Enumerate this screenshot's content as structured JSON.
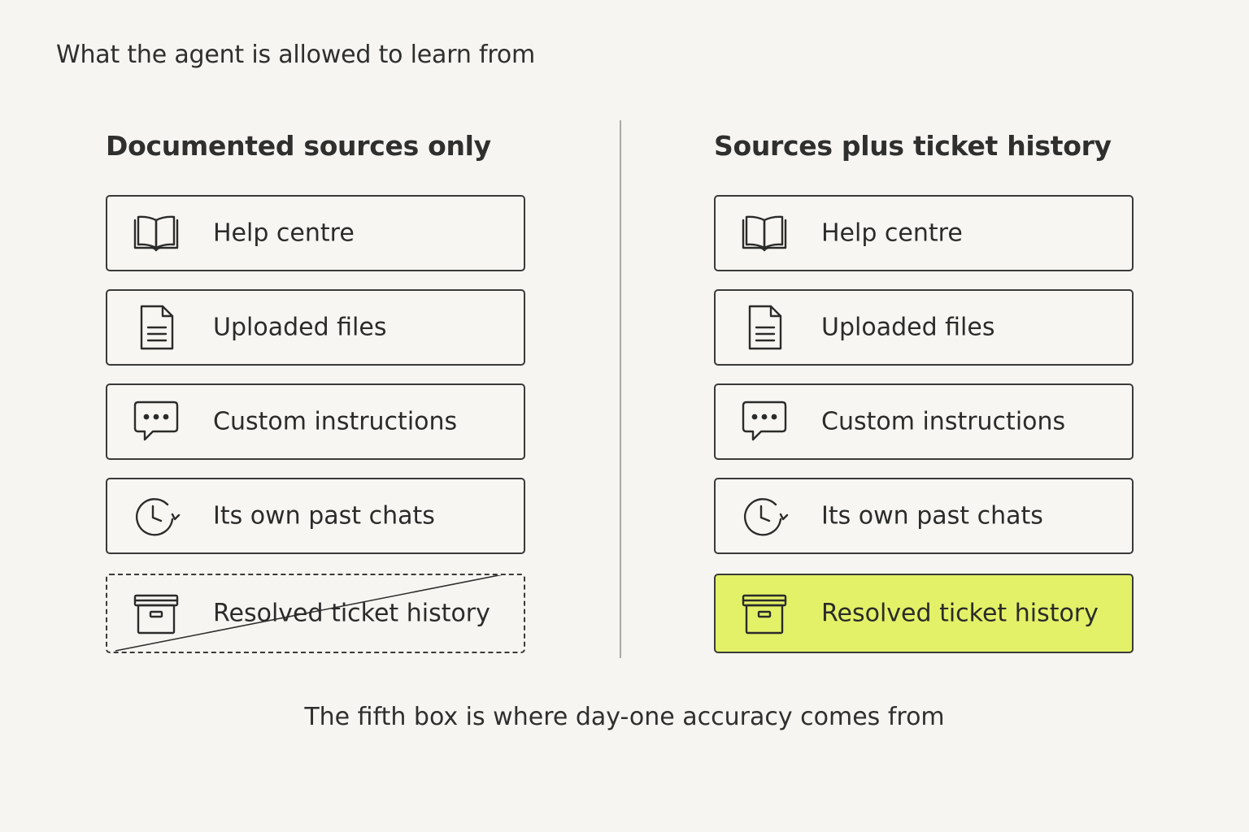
{
  "title": "What the agent is allowed to learn from",
  "columns": [
    {
      "heading": "Documented sources only",
      "items": [
        {
          "label": "Help centre",
          "icon": "book-icon"
        },
        {
          "label": "Uploaded files",
          "icon": "document-icon"
        },
        {
          "label": "Custom instructions",
          "icon": "chat-bubble-icon"
        },
        {
          "label": "Its own past chats",
          "icon": "history-clock-icon"
        },
        {
          "label": "Resolved ticket history",
          "icon": "archive-box-icon",
          "state": "excluded"
        }
      ]
    },
    {
      "heading": "Sources plus ticket history",
      "items": [
        {
          "label": "Help centre",
          "icon": "book-icon"
        },
        {
          "label": "Uploaded files",
          "icon": "document-icon"
        },
        {
          "label": "Custom instructions",
          "icon": "chat-bubble-icon"
        },
        {
          "label": "Its own past chats",
          "icon": "history-clock-icon"
        },
        {
          "label": "Resolved ticket history",
          "icon": "archive-box-icon",
          "state": "highlighted"
        }
      ]
    }
  ],
  "caption": "The fifth box is where day-one accuracy comes from",
  "colors": {
    "background": "#f6f5f2",
    "border": "#3a3a39",
    "highlight": "#e3f168",
    "divider": "#a9a9a6"
  }
}
